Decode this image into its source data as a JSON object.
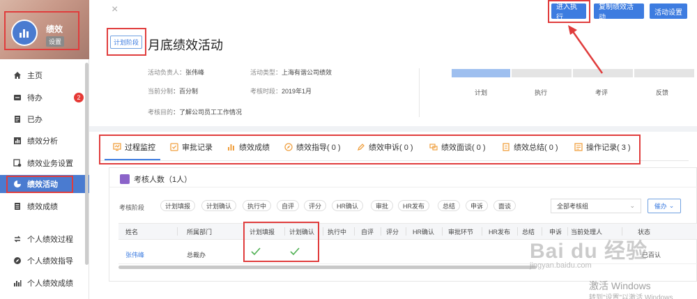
{
  "sidebar": {
    "user_name": "绩效",
    "settings_label": "设置",
    "items": [
      {
        "label": "主页",
        "icon": "home-icon"
      },
      {
        "label": "待办",
        "icon": "todo-icon",
        "badge": "2"
      },
      {
        "label": "已办",
        "icon": "done-icon"
      },
      {
        "label": "绩效分析",
        "icon": "analysis-icon"
      },
      {
        "label": "绩效业务设置",
        "icon": "business-settings-icon"
      },
      {
        "label": "绩效活动",
        "icon": "activity-icon",
        "active": true
      },
      {
        "label": "绩效成绩",
        "icon": "score-icon"
      },
      {
        "label": "个人绩效过程",
        "icon": "process-icon"
      },
      {
        "label": "个人绩效指导",
        "icon": "guide-icon"
      },
      {
        "label": "个人绩效成绩",
        "icon": "personal-score-icon"
      }
    ]
  },
  "header": {
    "close": "×",
    "buttons": {
      "execute": "进入执行",
      "copy": "复制绩效活动",
      "settings": "活动设置"
    }
  },
  "activity": {
    "stage_tag": "计划阶段",
    "title": "月底绩效活动",
    "owner_label": "活动负责人：",
    "owner": "张伟峰",
    "type_label": "活动类型：",
    "type": "上海有谐公司绩效",
    "score_label": "当前分制",
    "score": "：百分制",
    "period_label": "考核时段：",
    "period": "2019年1月",
    "goal_label": "考核目的",
    "goal": "：了解公司员工工作情况"
  },
  "progress": {
    "steps": [
      "计划",
      "执行",
      "考评",
      "反馈"
    ],
    "current_step": 1
  },
  "tabs": [
    {
      "label": "过程监控",
      "icon": "monitor-icon"
    },
    {
      "label": "审批记录",
      "icon": "approval-icon"
    },
    {
      "label": "绩效成绩",
      "icon": "chart-icon"
    },
    {
      "label": "绩效指导( 0 )",
      "icon": "compass-icon"
    },
    {
      "label": "绩效申诉( 0 )",
      "icon": "appeal-icon"
    },
    {
      "label": "绩效面谈( 0 )",
      "icon": "interview-icon"
    },
    {
      "label": "绩效总结( 0 )",
      "icon": "summary-icon"
    },
    {
      "label": "操作记录( 3 )",
      "icon": "log-icon"
    }
  ],
  "panel": {
    "count_title": "考核人数（1人）",
    "filter_label": "考核阶段",
    "chips": [
      "计划填报",
      "计划确认",
      "执行中",
      "自评",
      "评分",
      "HR确认",
      "审批",
      "HR发布",
      "总结",
      "申诉",
      "面谈"
    ],
    "group_select": "全部考核组",
    "urge": "催办"
  },
  "table": {
    "columns": [
      "姓名",
      "所属部门",
      "计划填报",
      "计划确认",
      "执行中",
      "自评",
      "评分",
      "HR确认",
      "审批环节",
      "HR发布",
      "总结",
      "申诉",
      "当前处理人",
      "状态"
    ],
    "rows": [
      {
        "name": "张伟峰",
        "dept": "总裁办",
        "plan_fill": "✓",
        "plan_confirm": "✓",
        "status": "已百认"
      }
    ]
  },
  "watermark": {
    "baidu": "Bai du 经验",
    "baidu_url": "jingyan.baidu.com",
    "windows": "激活 Windows",
    "windows_sub": "转到\"设置\"以激活 Windows"
  },
  "colors": {
    "accent": "#3d7ce0",
    "annotation": "#e03c3c",
    "badge": "#e53935"
  }
}
